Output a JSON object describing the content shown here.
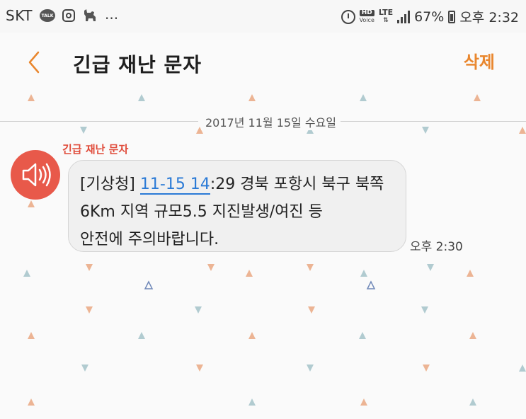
{
  "status_bar": {
    "carrier": "SKT",
    "kakaotalk_badge": "TALK",
    "notification_icons": [
      "kakaotalk-icon",
      "instagram-icon",
      "dog-icon"
    ],
    "more_indicator": "...",
    "hd_label": "HD",
    "voice_label": "Voice",
    "network": "LTE",
    "battery_percent": "67%",
    "time": "오후 2:32"
  },
  "header": {
    "title": "긴급 재난 문자",
    "delete_label": "삭제"
  },
  "conversation": {
    "date_divider": "2017년 11월 15일 수요일",
    "messages": [
      {
        "sender": "긴급 재난 문자",
        "text_prefix": "[기상청] ",
        "link_text": "11-15 14",
        "text_line1_rest": ":29 경북 포항시 북구 북쪽",
        "text_line2": "6Km 지역 규모5.5 지진발생/여진 등",
        "text_line3": "안전에 주의바랍니다.",
        "time": "오후 2:30"
      }
    ]
  },
  "colors": {
    "accent_orange": "#e9862d",
    "avatar_red": "#e8594a",
    "link_blue": "#2a7ad6",
    "pattern_orange": "#e9a37a",
    "pattern_teal": "#9fbfc6",
    "pattern_blue": "#6f88b8"
  }
}
